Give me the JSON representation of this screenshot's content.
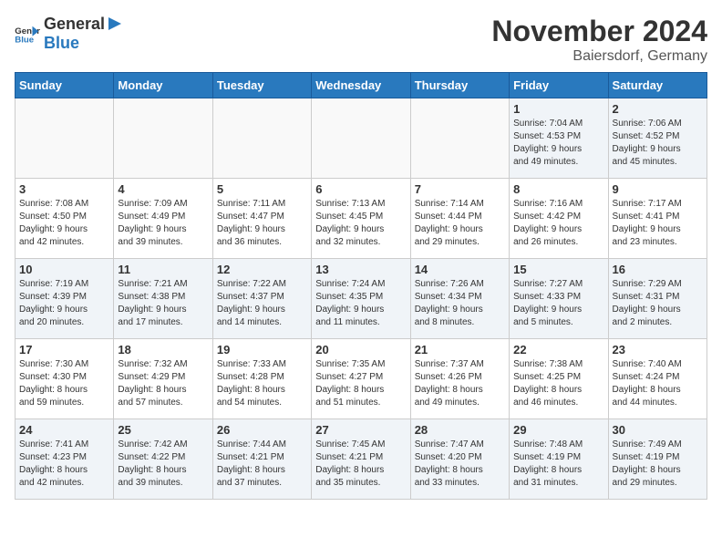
{
  "header": {
    "logo_general": "General",
    "logo_blue": "Blue",
    "month": "November 2024",
    "location": "Baiersdorf, Germany"
  },
  "weekdays": [
    "Sunday",
    "Monday",
    "Tuesday",
    "Wednesday",
    "Thursday",
    "Friday",
    "Saturday"
  ],
  "weeks": [
    [
      {
        "day": "",
        "info": ""
      },
      {
        "day": "",
        "info": ""
      },
      {
        "day": "",
        "info": ""
      },
      {
        "day": "",
        "info": ""
      },
      {
        "day": "",
        "info": ""
      },
      {
        "day": "1",
        "info": "Sunrise: 7:04 AM\nSunset: 4:53 PM\nDaylight: 9 hours\nand 49 minutes."
      },
      {
        "day": "2",
        "info": "Sunrise: 7:06 AM\nSunset: 4:52 PM\nDaylight: 9 hours\nand 45 minutes."
      }
    ],
    [
      {
        "day": "3",
        "info": "Sunrise: 7:08 AM\nSunset: 4:50 PM\nDaylight: 9 hours\nand 42 minutes."
      },
      {
        "day": "4",
        "info": "Sunrise: 7:09 AM\nSunset: 4:49 PM\nDaylight: 9 hours\nand 39 minutes."
      },
      {
        "day": "5",
        "info": "Sunrise: 7:11 AM\nSunset: 4:47 PM\nDaylight: 9 hours\nand 36 minutes."
      },
      {
        "day": "6",
        "info": "Sunrise: 7:13 AM\nSunset: 4:45 PM\nDaylight: 9 hours\nand 32 minutes."
      },
      {
        "day": "7",
        "info": "Sunrise: 7:14 AM\nSunset: 4:44 PM\nDaylight: 9 hours\nand 29 minutes."
      },
      {
        "day": "8",
        "info": "Sunrise: 7:16 AM\nSunset: 4:42 PM\nDaylight: 9 hours\nand 26 minutes."
      },
      {
        "day": "9",
        "info": "Sunrise: 7:17 AM\nSunset: 4:41 PM\nDaylight: 9 hours\nand 23 minutes."
      }
    ],
    [
      {
        "day": "10",
        "info": "Sunrise: 7:19 AM\nSunset: 4:39 PM\nDaylight: 9 hours\nand 20 minutes."
      },
      {
        "day": "11",
        "info": "Sunrise: 7:21 AM\nSunset: 4:38 PM\nDaylight: 9 hours\nand 17 minutes."
      },
      {
        "day": "12",
        "info": "Sunrise: 7:22 AM\nSunset: 4:37 PM\nDaylight: 9 hours\nand 14 minutes."
      },
      {
        "day": "13",
        "info": "Sunrise: 7:24 AM\nSunset: 4:35 PM\nDaylight: 9 hours\nand 11 minutes."
      },
      {
        "day": "14",
        "info": "Sunrise: 7:26 AM\nSunset: 4:34 PM\nDaylight: 9 hours\nand 8 minutes."
      },
      {
        "day": "15",
        "info": "Sunrise: 7:27 AM\nSunset: 4:33 PM\nDaylight: 9 hours\nand 5 minutes."
      },
      {
        "day": "16",
        "info": "Sunrise: 7:29 AM\nSunset: 4:31 PM\nDaylight: 9 hours\nand 2 minutes."
      }
    ],
    [
      {
        "day": "17",
        "info": "Sunrise: 7:30 AM\nSunset: 4:30 PM\nDaylight: 8 hours\nand 59 minutes."
      },
      {
        "day": "18",
        "info": "Sunrise: 7:32 AM\nSunset: 4:29 PM\nDaylight: 8 hours\nand 57 minutes."
      },
      {
        "day": "19",
        "info": "Sunrise: 7:33 AM\nSunset: 4:28 PM\nDaylight: 8 hours\nand 54 minutes."
      },
      {
        "day": "20",
        "info": "Sunrise: 7:35 AM\nSunset: 4:27 PM\nDaylight: 8 hours\nand 51 minutes."
      },
      {
        "day": "21",
        "info": "Sunrise: 7:37 AM\nSunset: 4:26 PM\nDaylight: 8 hours\nand 49 minutes."
      },
      {
        "day": "22",
        "info": "Sunrise: 7:38 AM\nSunset: 4:25 PM\nDaylight: 8 hours\nand 46 minutes."
      },
      {
        "day": "23",
        "info": "Sunrise: 7:40 AM\nSunset: 4:24 PM\nDaylight: 8 hours\nand 44 minutes."
      }
    ],
    [
      {
        "day": "24",
        "info": "Sunrise: 7:41 AM\nSunset: 4:23 PM\nDaylight: 8 hours\nand 42 minutes."
      },
      {
        "day": "25",
        "info": "Sunrise: 7:42 AM\nSunset: 4:22 PM\nDaylight: 8 hours\nand 39 minutes."
      },
      {
        "day": "26",
        "info": "Sunrise: 7:44 AM\nSunset: 4:21 PM\nDaylight: 8 hours\nand 37 minutes."
      },
      {
        "day": "27",
        "info": "Sunrise: 7:45 AM\nSunset: 4:21 PM\nDaylight: 8 hours\nand 35 minutes."
      },
      {
        "day": "28",
        "info": "Sunrise: 7:47 AM\nSunset: 4:20 PM\nDaylight: 8 hours\nand 33 minutes."
      },
      {
        "day": "29",
        "info": "Sunrise: 7:48 AM\nSunset: 4:19 PM\nDaylight: 8 hours\nand 31 minutes."
      },
      {
        "day": "30",
        "info": "Sunrise: 7:49 AM\nSunset: 4:19 PM\nDaylight: 8 hours\nand 29 minutes."
      }
    ]
  ]
}
